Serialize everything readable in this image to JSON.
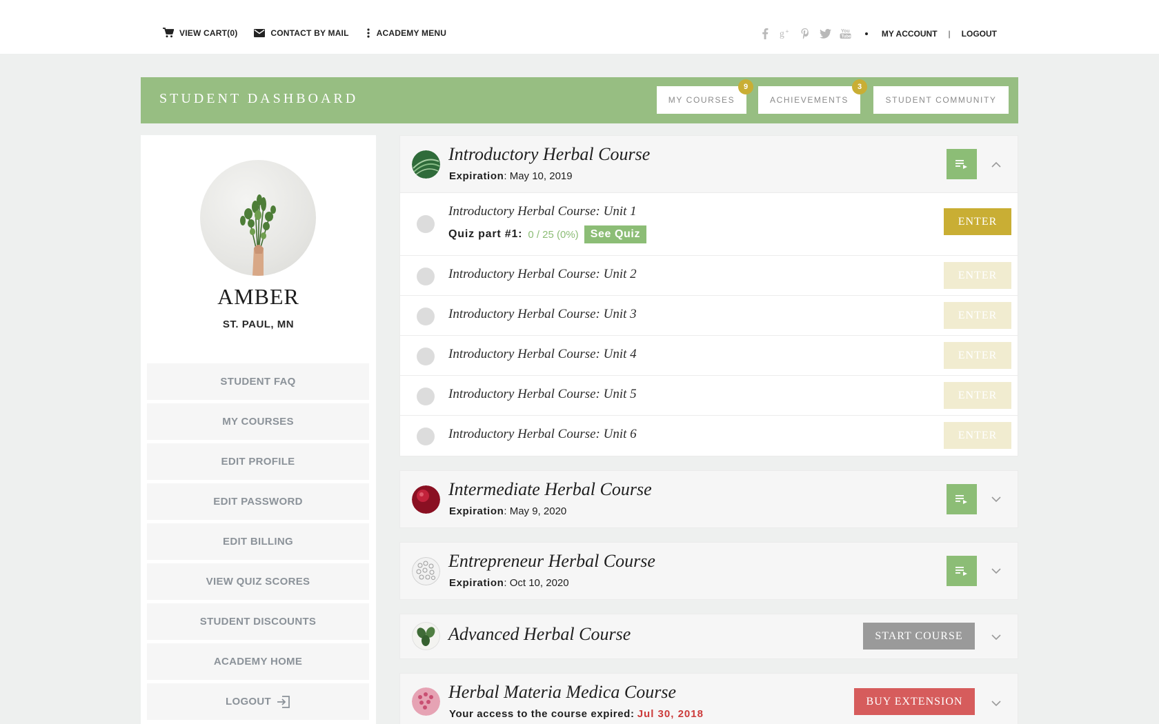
{
  "topbar": {
    "view_cart": "VIEW CART(0)",
    "contact": "CONTACT BY MAIL",
    "academy_menu": "ACADEMY MENU",
    "my_account": "MY ACCOUNT",
    "separator": "|",
    "logout": "LOGOUT",
    "social_icons": [
      "facebook-icon",
      "google-plus-icon",
      "pinterest-icon",
      "twitter-icon",
      "youtube-icon"
    ]
  },
  "header": {
    "title": "STUDENT DASHBOARD",
    "buttons": [
      {
        "label": "MY COURSES",
        "badge": "9"
      },
      {
        "label": "ACHIEVEMENTS",
        "badge": "3"
      },
      {
        "label": "STUDENT COMMUNITY"
      }
    ]
  },
  "profile": {
    "name": "AMBER",
    "location": "ST. PAUL, MN"
  },
  "sidebar": {
    "items": [
      {
        "label": "STUDENT FAQ"
      },
      {
        "label": "MY COURSES"
      },
      {
        "label": "EDIT PROFILE"
      },
      {
        "label": "EDIT PASSWORD"
      },
      {
        "label": "EDIT BILLING"
      },
      {
        "label": "VIEW QUIZ SCORES"
      },
      {
        "label": "STUDENT DISCOUNTS"
      },
      {
        "label": "ACADEMY HOME"
      },
      {
        "label": "LOGOUT"
      }
    ]
  },
  "courses": [
    {
      "title": "Introductory Herbal Course",
      "exp_label": "Expiration",
      "exp_date": "May 10, 2019",
      "expanded": true,
      "units": [
        {
          "title": "Introductory Herbal Course: Unit 1",
          "quiz_label": "Quiz part #1:",
          "quiz_score": "0 / 25 (0%)",
          "see_quiz": "See Quiz",
          "enter": "ENTER",
          "active": true
        },
        {
          "title": "Introductory Herbal Course: Unit 2",
          "enter": "ENTER",
          "active": false
        },
        {
          "title": "Introductory Herbal Course: Unit 3",
          "enter": "ENTER",
          "active": false
        },
        {
          "title": "Introductory Herbal Course: Unit 4",
          "enter": "ENTER",
          "active": false
        },
        {
          "title": "Introductory Herbal Course: Unit 5",
          "enter": "ENTER",
          "active": false
        },
        {
          "title": "Introductory Herbal Course: Unit 6",
          "enter": "ENTER",
          "active": false
        }
      ]
    },
    {
      "title": "Intermediate Herbal Course",
      "exp_label": "Expiration",
      "exp_date": "May 9, 2020"
    },
    {
      "title": "Entrepreneur Herbal Course",
      "exp_label": "Expiration",
      "exp_date": "Oct 10, 2020"
    },
    {
      "title": "Advanced Herbal Course",
      "action": "START COURSE"
    },
    {
      "title": "Herbal Materia Medica Course",
      "exp_label": "Your access to the course expired:",
      "exp_date": "Jul 30, 2018",
      "action": "BUY EXTENSION"
    }
  ],
  "colors": {
    "header_green": "#97be82",
    "button_green": "#8cbd76",
    "enter_gold": "#c9ae34",
    "enter_disabled": "#f1ecd0",
    "start_gray": "#9a9a9a",
    "buy_red": "#d65c5c",
    "expired_red": "#cc3b3b"
  }
}
